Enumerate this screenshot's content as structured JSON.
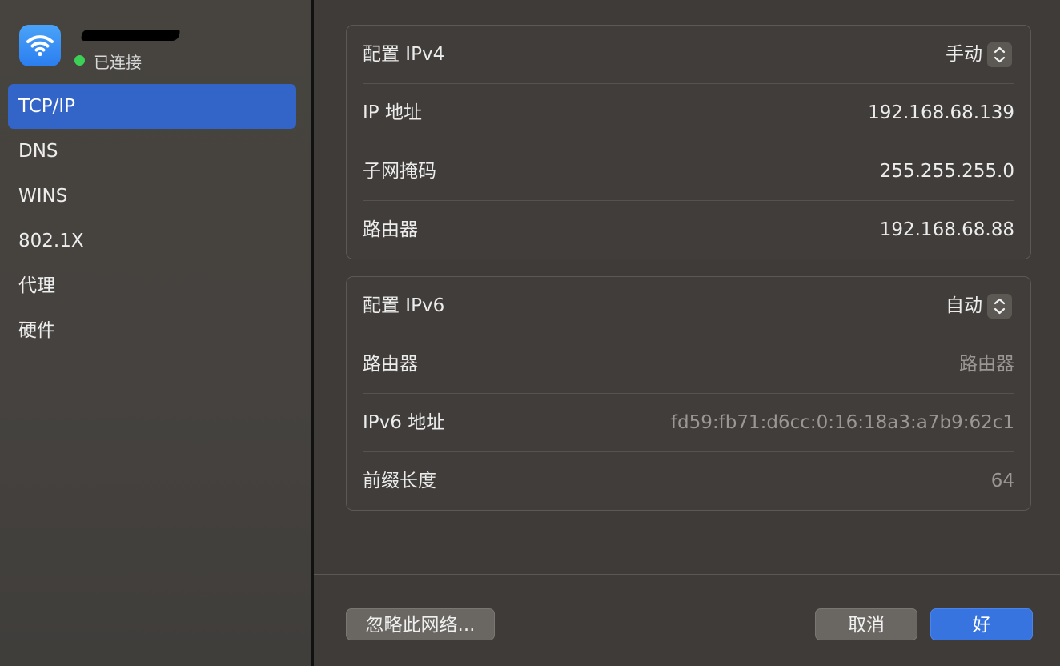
{
  "sidebar": {
    "network": {
      "status": "已连接",
      "status_color": "#3cd056",
      "icon": "wifi-icon"
    },
    "items": [
      {
        "label": "TCP/IP",
        "active": true
      },
      {
        "label": "DNS",
        "active": false
      },
      {
        "label": "WINS",
        "active": false
      },
      {
        "label": "802.1X",
        "active": false
      },
      {
        "label": "代理",
        "active": false
      },
      {
        "label": "硬件",
        "active": false
      }
    ]
  },
  "ipv4": {
    "config_label": "配置 IPv4",
    "config_value": "手动",
    "rows": [
      {
        "label": "IP 地址",
        "value": "192.168.68.139"
      },
      {
        "label": "子网掩码",
        "value": "255.255.255.0"
      },
      {
        "label": "路由器",
        "value": "192.168.68.88"
      }
    ]
  },
  "ipv6": {
    "config_label": "配置 IPv6",
    "config_value": "自动",
    "rows": [
      {
        "label": "路由器",
        "value": "路由器"
      },
      {
        "label": "IPv6 地址",
        "value": "fd59:fb71:d6cc:0:16:18a3:a7b9:62c1"
      },
      {
        "label": "前缀长度",
        "value": "64"
      }
    ]
  },
  "footer": {
    "forget_label": "忽略此网络...",
    "cancel_label": "取消",
    "ok_label": "好"
  },
  "colors": {
    "accent": "#3364c8",
    "ok_button": "#3774e0"
  }
}
